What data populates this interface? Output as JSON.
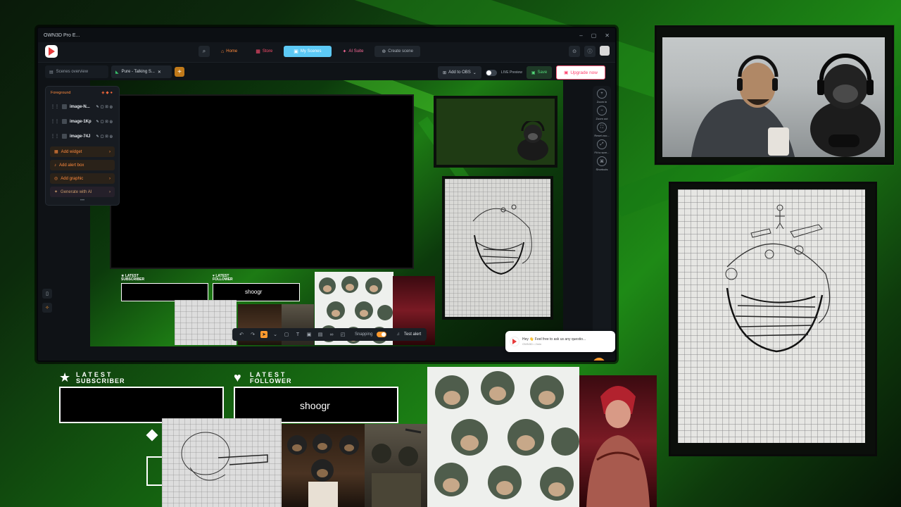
{
  "window": {
    "title": "OWN3D Pro E...",
    "controls": [
      "–",
      "▢",
      "✕"
    ]
  },
  "nav": {
    "search_icon": "search-icon",
    "items": [
      {
        "label": "Home",
        "icon": "⌂"
      },
      {
        "label": "Store",
        "icon": "▦"
      },
      {
        "label": "My Scenes",
        "icon": "▣"
      },
      {
        "label": "AI Suite",
        "icon": "✦"
      },
      {
        "label": "Create scene",
        "icon": "⊕"
      }
    ]
  },
  "tabs": {
    "overview": "Scenes overview",
    "current": "Pure - Talking S...",
    "add": "+"
  },
  "toolbar": {
    "add_to_obs": "Add to OBS",
    "live_preview": "LIVE Preview",
    "save": "Save",
    "upgrade": "Upgrade now"
  },
  "layers": {
    "title": "Foreground",
    "items": [
      "image-N...",
      "image-1Kp",
      "image-74J"
    ],
    "buttons": [
      "Add widget",
      "Add alert box",
      "Add graphic",
      "Generate with AI"
    ]
  },
  "right_rail": [
    "Zoom in",
    "Zoom out",
    "Reset zoo...",
    "Fit to scre...",
    "Shortcuts"
  ],
  "bottom_bar": {
    "snapping": "Snapping",
    "test_alert": "Test alert"
  },
  "chat": {
    "message": "Hey 👋 Feel free to ask us any questio...",
    "meta": "OWN3D • 2min"
  },
  "widgets": {
    "subscriber_top": "LATEST",
    "subscriber_bottom": "SUBSCRIBER",
    "follower_top": "LATEST",
    "follower_bottom": "FOLLOWER",
    "follower_name": "shoogr"
  },
  "colors": {
    "accent_orange": "#ff9a2e",
    "scenes_blue": "#5cc9f5",
    "upgrade_red": "#ff3d6b",
    "overlay_green": "#1e8a16"
  }
}
